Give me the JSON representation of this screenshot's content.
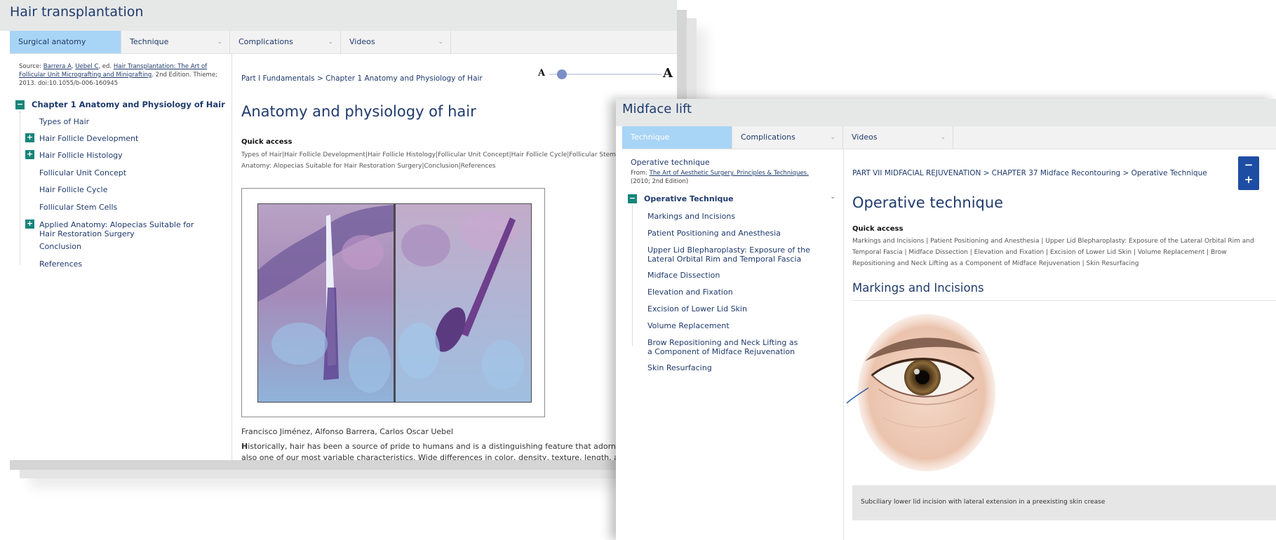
{
  "window1": {
    "title": "Hair transplantation",
    "tabs": [
      {
        "label": "Surgical anatomy",
        "active": true,
        "dropdown": false
      },
      {
        "label": "Technique",
        "active": false,
        "dropdown": true
      },
      {
        "label": "Complications",
        "active": false,
        "dropdown": true
      },
      {
        "label": "Videos",
        "active": false,
        "dropdown": true
      }
    ],
    "source": {
      "prefix": "Source: ",
      "author1": "Barrera A",
      "sep1": ", ",
      "author2": "Uebel C",
      "middle": ", ed. ",
      "book": "Hair Transplantation: The Art of Follicular Unit Micrografting and Minigrafting",
      "suffix": ". 2nd Edition. Thieme; 2013. doi:10.1055/b-006-160945"
    },
    "toc": {
      "chapter": "Chapter 1 Anatomy and Physiology of Hair",
      "chapter_icon": "minus-box-icon",
      "items": [
        {
          "label": "Types of Hair",
          "expandable": false
        },
        {
          "label": "Hair Follicle Development",
          "expandable": true
        },
        {
          "label": "Hair Follicle Histology",
          "expandable": true
        },
        {
          "label": "Follicular Unit Concept",
          "expandable": false
        },
        {
          "label": "Hair Follicle Cycle",
          "expandable": false
        },
        {
          "label": "Follicular Stem Cells",
          "expandable": false
        },
        {
          "label": "Applied Anatomy: Alopecias Suitable for Hair Restoration Surgery",
          "expandable": true
        },
        {
          "label": "Conclusion",
          "expandable": false
        },
        {
          "label": "References",
          "expandable": false
        }
      ]
    },
    "breadcrumb": "Part I Fundamentals > Chapter 1 Anatomy and Physiology of Hair",
    "font_slider": {
      "small_label": "A",
      "large_label": "A",
      "level": 0.2
    },
    "heading": "Anatomy and physiology of hair",
    "quick_access": {
      "label": "Quick access",
      "line1": "Types of Hair|Hair Follicle Development|Hair Follicle Histology|Follicular Unit Concept|Hair Follicle Cycle|Follicular Stem",
      "line2": "Anatomy: Alopecias Suitable for Hair Restoration Surgery|Conclusion|References"
    },
    "authors": "Francisco Jiménez, Alfonso Barrera, Carlos Oscar Uebel",
    "body_first_letter": "H",
    "body_line1": "istorically, hair has been a source of pride to humans and is a distinguishing feature that adorns as well as",
    "body_line2": "also one of our most variable characteristics. Wide differences in color, density, texture, length, and style dis"
  },
  "window2": {
    "title": "Midface lift",
    "tabs": [
      {
        "label": "Technique",
        "active": true,
        "dropdown": false
      },
      {
        "label": "Complications",
        "active": false,
        "dropdown": true
      },
      {
        "label": "Videos",
        "active": false,
        "dropdown": true
      }
    ],
    "sidebar_title": "Operative technique",
    "from_prefix": "From: ",
    "from_link": "The Art of Aesthetic Surgery. Principles & Techniques.",
    "from_suffix": "(2010; 2nd Edition)",
    "toc": {
      "heading": "Operative Technique",
      "items": [
        "Markings and Incisions",
        "Patient Positioning and Anesthesia",
        "Upper Lid Blepharoplasty: Exposure of the Lateral Orbital Rim and Temporal Fascia",
        "Midface Dissection",
        "Elevation and Fixation",
        "Excision of Lower Lid Skin",
        "Volume Replacement",
        "Brow Repositioning and Neck Lifting as a Component of Midface Rejuvenation",
        "Skin Resurfacing"
      ]
    },
    "breadcrumb": "PART VII MIDFACIAL REJUVENATION > CHAPTER 37 Midface Recontouring > Operative Technique",
    "heading": "Operative technique",
    "quick_access": {
      "label": "Quick access",
      "line1": "Markings and Incisions | Patient Positioning and Anesthesia | Upper Lid Blepharoplasty: Exposure of the Lateral Orbital Rim and",
      "line2": "Temporal Fascia | Midface Dissection | Elevation and Fixation | Excision of Lower Lid Skin | Volume Replacement | Brow",
      "line3": "Repositioning and Neck Lifting as a Component of Midface Rejuvenation | Skin Resurfacing"
    },
    "section_heading": "Markings and Incisions",
    "figure_caption": "Subciliary lower lid incision with lateral extension in a preexisting skin crease",
    "zoom_out": "−",
    "zoom_in": "+"
  },
  "colors": {
    "accent": "#1f3a6d",
    "active_tab": "#a8d4f5",
    "expand_box": "#16857a",
    "titlebar": "#e6e8e8",
    "zoom_button": "#1d4ea3"
  }
}
